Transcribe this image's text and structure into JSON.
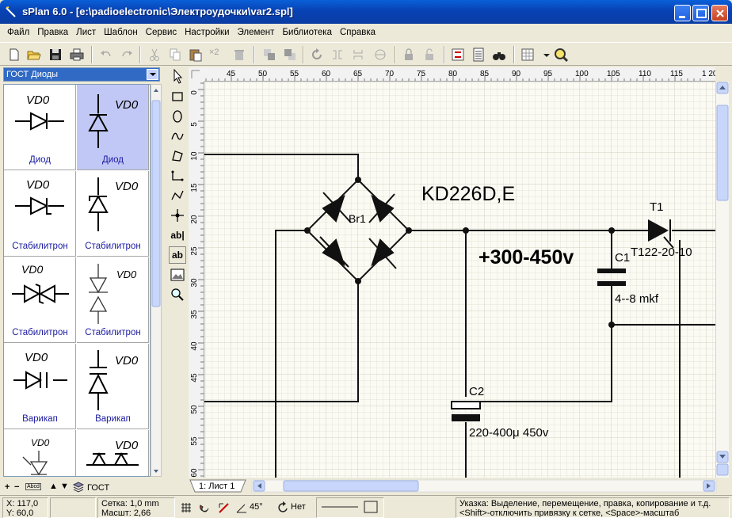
{
  "window": {
    "title": "sPlan 6.0 - [e:\\padioelectronic\\Электроудочки\\var2.spl]"
  },
  "menu": [
    "Файл",
    "Правка",
    "Лист",
    "Шаблон",
    "Сервис",
    "Настройки",
    "Элемент",
    "Библиотека",
    "Справка"
  ],
  "toolbar": {
    "x2_label": "×2"
  },
  "library": {
    "selected": "ГОСТ Диоды",
    "footer_label": "ГОСТ",
    "footer_button": "Abcd",
    "items": [
      {
        "designator": "VD0",
        "label": "Диод"
      },
      {
        "designator": "VD0",
        "label": "Диод"
      },
      {
        "designator": "VD0",
        "label": "Стабилитрон"
      },
      {
        "designator": "VD0",
        "label": "Стабилитрон"
      },
      {
        "designator": "VD0",
        "label": "Стабилитрон"
      },
      {
        "designator": "VD0",
        "label": "Стабилитрон"
      },
      {
        "designator": "VD0",
        "label": "Варикап"
      },
      {
        "designator": "VD0",
        "label": "Варикап"
      },
      {
        "designator": "VD0",
        "label": ""
      },
      {
        "designator": "VD0",
        "label": ""
      }
    ]
  },
  "tools": {
    "text_tool_1": "ab|",
    "text_tool_2": "ab"
  },
  "ruler": {
    "h_ticks": [
      "45",
      "50",
      "55",
      "60",
      "65",
      "70",
      "75",
      "80",
      "85",
      "90",
      "95",
      "100",
      "105",
      "110",
      "115",
      "1 20"
    ],
    "v_ticks": [
      "0",
      "5",
      "10",
      "15",
      "20",
      "25",
      "30",
      "35",
      "40",
      "45",
      "50",
      "55",
      "60"
    ]
  },
  "schematic": {
    "bridge_label": "Br1",
    "bridge_part": "KD226D,E",
    "voltage_label": "+300-450v",
    "c1_label": "C1",
    "c1_value": "4--8 mkf",
    "c2_label": "C2",
    "c2_value": "220-400μ 450v",
    "t1_label": "T1",
    "t1_part": "T122-20-10"
  },
  "sheet_tab": "1: Лист 1",
  "status": {
    "x": "X: 117,0",
    "y": "Y: 60,0",
    "grid": "Сетка:  1,0 mm",
    "scale": "Масшт:  2,66",
    "angle": "45°",
    "snap": "Нет",
    "hint_1": "Указка: Выделение, перемещение, правка, копирование и т.д.",
    "hint_2": "<Shift>-отключить привязку к сетке, <Space>-масштаб"
  },
  "colors": {
    "title_bar": "#0842b4",
    "selection": "#c1c8f5",
    "combo_highlight": "#316ac5",
    "label_blue": "#1a1aa0"
  }
}
